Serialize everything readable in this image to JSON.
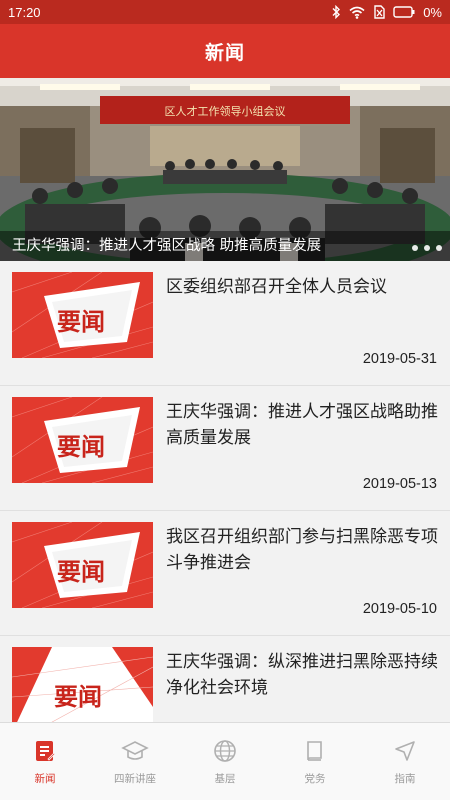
{
  "status_bar": {
    "time": "17:20",
    "battery": "0%",
    "icons": [
      "bluetooth-icon",
      "wifi-icon",
      "no-sim-icon",
      "battery-icon"
    ]
  },
  "header": {
    "title": "新闻"
  },
  "banner": {
    "caption": "王庆华强调：推进人才强区战略 助推高质量发展",
    "sign_text": "区人才工作领导小组会议",
    "dots": 3
  },
  "news": [
    {
      "title": "区委组织部召开全体人员会议",
      "date": "2019-05-31",
      "thumb_text": "要闻"
    },
    {
      "title": "王庆华强调：推进人才强区战略助推高质量发展",
      "date": "2019-05-13",
      "thumb_text": "要闻"
    },
    {
      "title": "我区召开组织部门参与扫黑除恶专项斗争推进会",
      "date": "2019-05-10",
      "thumb_text": "要闻"
    },
    {
      "title": "王庆华强调：纵深推进扫黑除恶持续净化社会环境",
      "date": "",
      "thumb_text": "要闻"
    }
  ],
  "tabs": [
    {
      "label": "新闻",
      "icon": "news-icon",
      "active": true
    },
    {
      "label": "四新讲座",
      "icon": "graduation-cap-icon",
      "active": false
    },
    {
      "label": "基层",
      "icon": "globe-icon",
      "active": false
    },
    {
      "label": "党务",
      "icon": "book-icon",
      "active": false
    },
    {
      "label": "指南",
      "icon": "navigation-arrow-icon",
      "active": false
    }
  ],
  "colors": {
    "primary": "#d9352a",
    "status_bar": "#ba2a1f",
    "active_tab": "#d9352a",
    "inactive_tab": "#9a9a9a"
  }
}
